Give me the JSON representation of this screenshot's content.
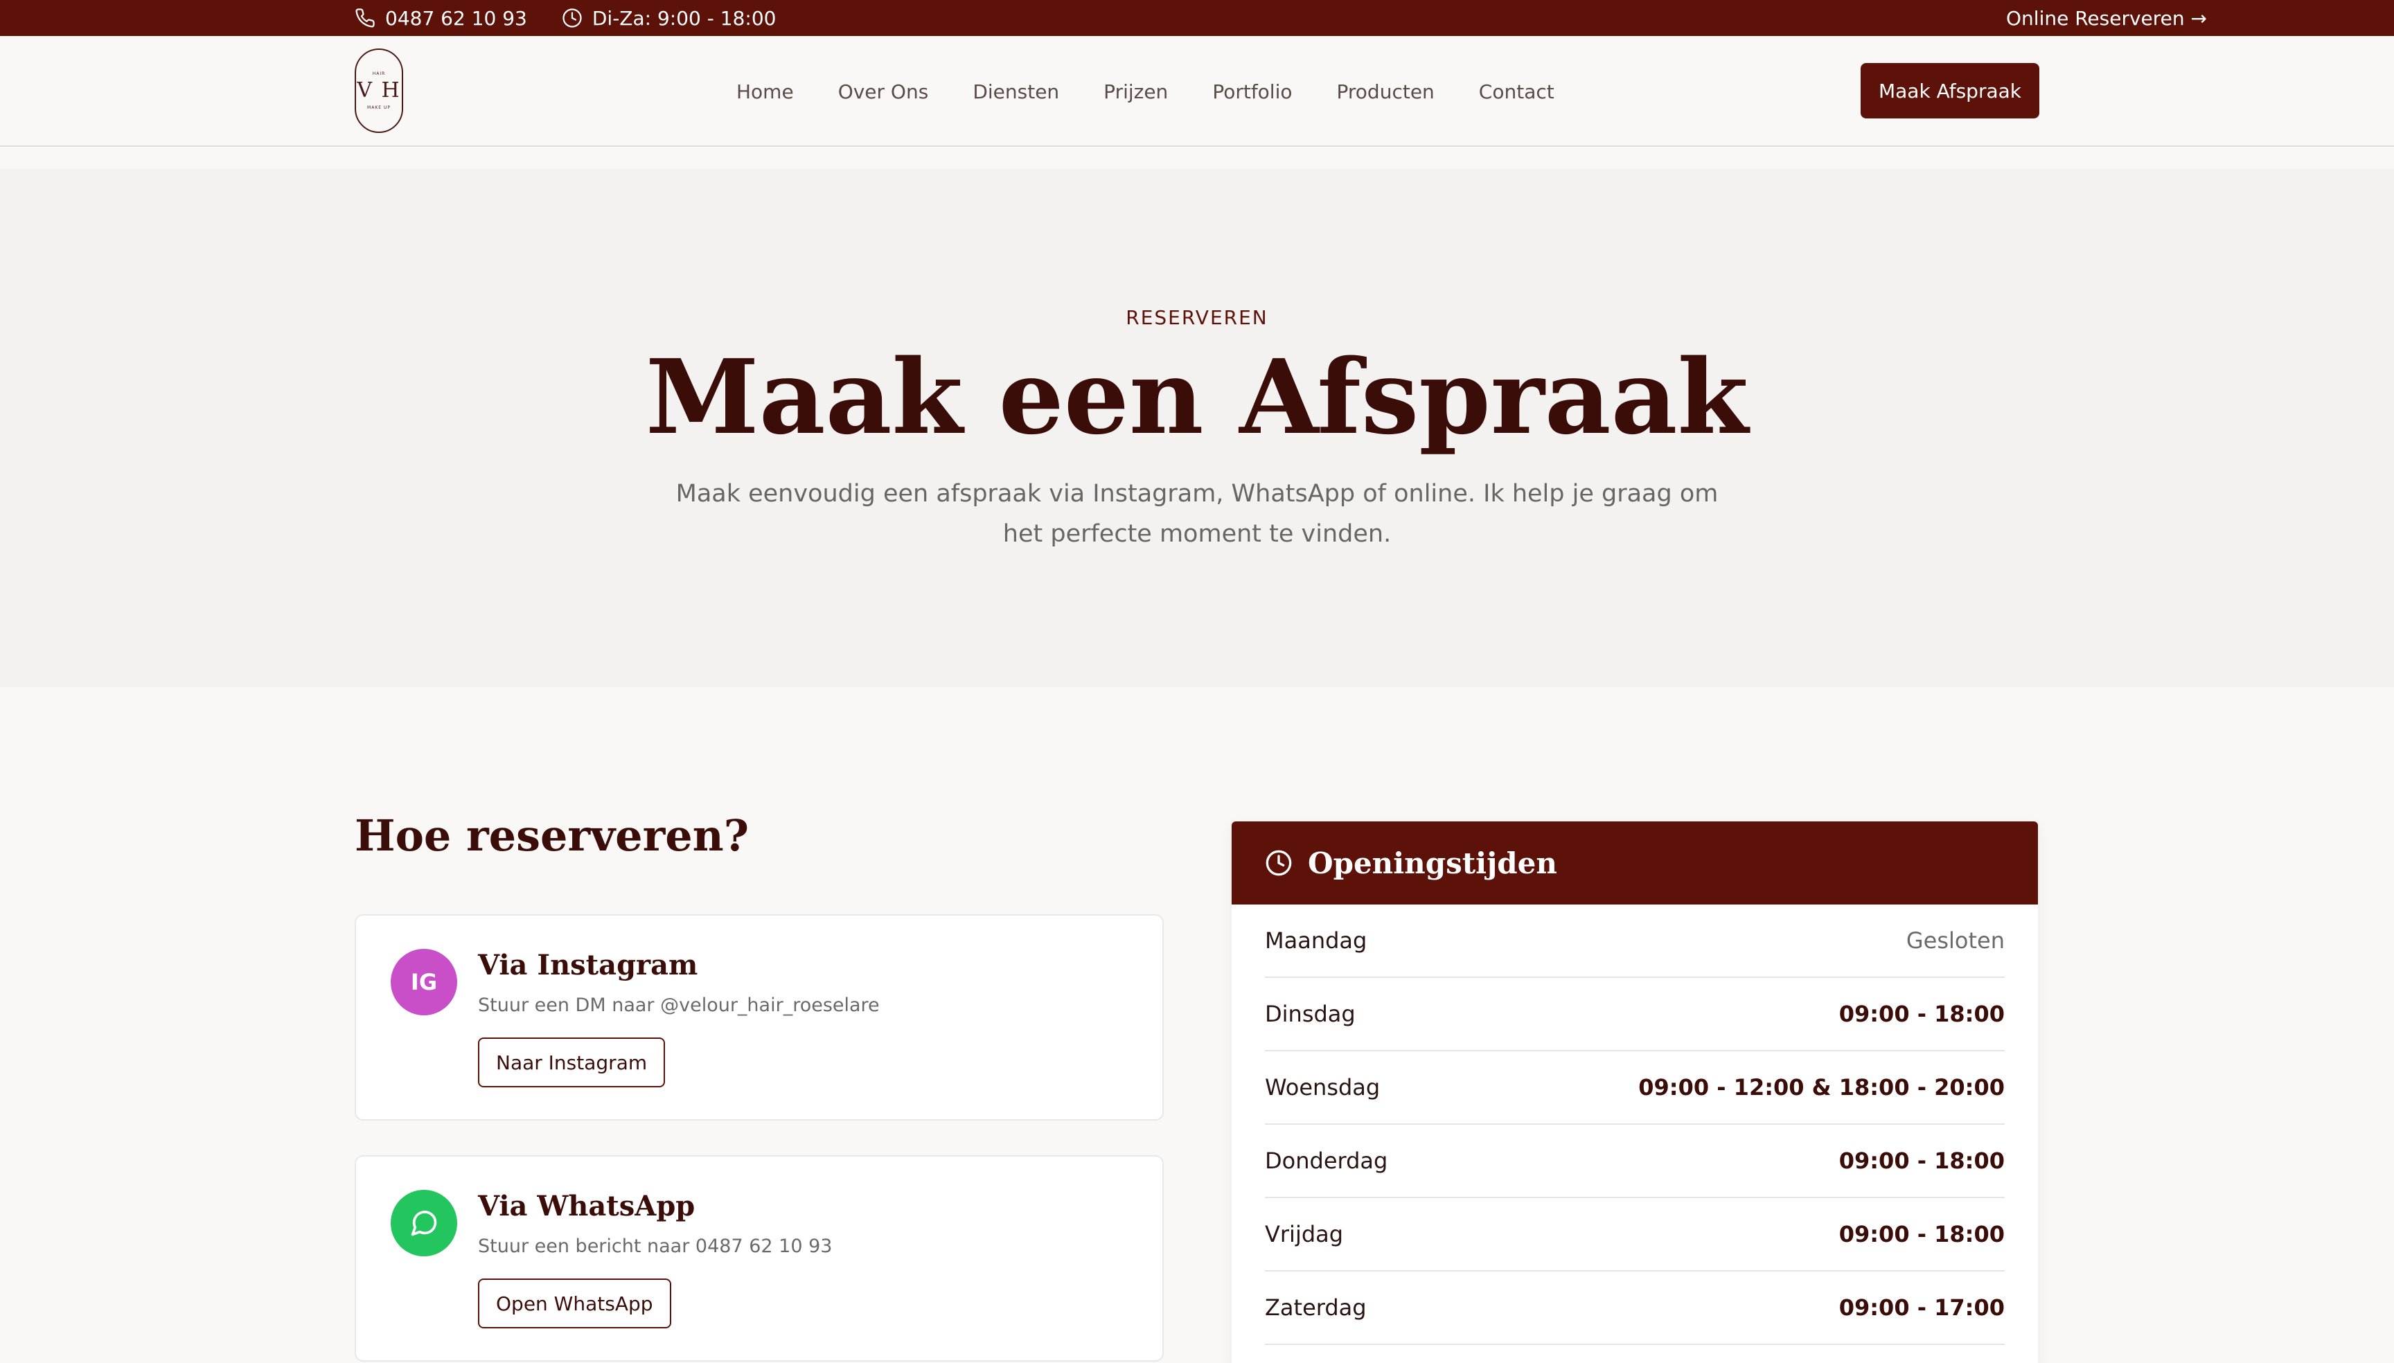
{
  "topbar": {
    "phone": "0487 62 10 93",
    "hours": "Di-Za: 9:00 - 18:00",
    "online_link": "Online Reserveren →",
    "bg_color": "#5c1208"
  },
  "header": {
    "logo": {
      "small_top": "HAIR",
      "main": "V H",
      "small_bottom": "MAKE UP"
    },
    "nav": [
      "Home",
      "Over Ons",
      "Diensten",
      "Prijzen",
      "Portfolio",
      "Producten",
      "Contact"
    ],
    "cta_label": "Maak Afspraak"
  },
  "hero": {
    "eyebrow": "RESERVEREN",
    "title": "Maak een Afspraak",
    "subtitle": "Maak eenvoudig een afspraak via Instagram, WhatsApp of online. Ik help je graag om het perfecte moment te vinden."
  },
  "booking": {
    "title": "Hoe reserveren?",
    "cards": [
      {
        "icon": "instagram-icon",
        "icon_text": "IG",
        "icon_color": "#c94fc9",
        "title": "Via Instagram",
        "description": "Stuur een DM naar @velour_hair_roeselare",
        "button": "Naar Instagram"
      },
      {
        "icon": "whatsapp-icon",
        "icon_color": "#22c55e",
        "title": "Via WhatsApp",
        "description": "Stuur een bericht naar 0487 62 10 93",
        "button": "Open WhatsApp"
      }
    ]
  },
  "opening_hours": {
    "title": "Openingstijden",
    "rows": [
      {
        "day": "Maandag",
        "time": "Gesloten"
      },
      {
        "day": "Dinsdag",
        "time": "09:00 - 18:00"
      },
      {
        "day": "Woensdag",
        "time": "09:00 - 12:00 & 18:00 - 20:00"
      },
      {
        "day": "Donderdag",
        "time": "09:00 - 18:00"
      },
      {
        "day": "Vrijdag",
        "time": "09:00 - 18:00"
      },
      {
        "day": "Zaterdag",
        "time": "09:00 - 17:00"
      }
    ]
  }
}
